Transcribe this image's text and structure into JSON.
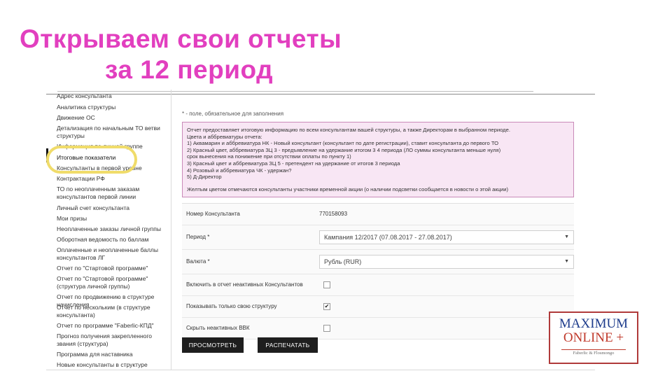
{
  "slide": {
    "title_line1": "Открываем свои отчеты",
    "title_line2": "за 12 период"
  },
  "sidebar": {
    "items": [
      "Адрес консультанта",
      "Аналитика структуры",
      "Движение ОС",
      "Детализация по начальным ТО ветви структуры",
      "Информация по личной группе",
      "Итоговые показатели",
      "Консультанты в первой уровне",
      "Контрактации РФ",
      "ТО по неоплаченным заказам консультантов первой линии",
      "Личный счет консультанта",
      "Мои призы",
      "Неоплаченные заказы личной группы",
      "Оборотная ведомость по баллам",
      "Оплаченные и неоплаченные баллы консультантов ЛГ",
      "Отчет по \"Стартовой программе\"",
      "Отчет по \"Стартовой программе\" (структура личной группы)",
      "Отчет по продвижению в структуре начисления",
      "Отчет по нескольким (в структуре консультанта)",
      "Отчет по программе \"Faberlic-КПД\"",
      "Прогноз получения закрепленного звания (структура)",
      "Программа для наставника",
      "Новые консультанты в структуре"
    ]
  },
  "main": {
    "note": "* - поле, обязательное для заполнения",
    "info_lines": [
      "Отчет предоставляет итоговую информацию по всем консультантам вашей структуры, а также Директорам в выбранном периоде.",
      "Цвета и аббревиатуры отчета:",
      "1) Аквамарин и аббревиатура НК - Новый консультант (консультант по дате регистрации), ставит консультанта до первого ТО",
      "2) Красный цвет, аббревиатура ЗЦ 3 - предъявление на удержание итогом 3 4 периода (ЛО суммы консультанта меньше нуля)",
      "срок вынесения на понижение при отсутствии оплаты по пункту 1)",
      "3) Красный цвет и аббревиатура ЗЦ 5 - претендент на удержание от итогов 3 периода",
      "4) Розовый и аббревиатура ЧК - удержан?",
      "5) Д-Директор"
    ],
    "info_footer": "Желтым цветом отмечаются консультанты участники временной акции (о наличии подсветки сообщается в новости о этой акции)",
    "consultant_label": "Номер Консультанта",
    "consultant_value": "770158093",
    "period_label": "Период *",
    "period_value": "Кампания 12/2017 (07.08.2017 - 27.08.2017)",
    "currency_label": "Валюта *",
    "currency_value": "Рубль (RUR)",
    "cb1_label": "Включить в отчет неактивных Консультантов",
    "cb2_label": "Показывать только свою структуру",
    "cb3_label": "Скрыть неактивных ВВК",
    "cb1_checked": "",
    "cb2_checked": "✔",
    "cb3_checked": "",
    "btn_view": "ПРОСМОТРЕТЬ",
    "btn_print": "РАСПЕЧАТАТЬ"
  },
  "logo": {
    "line1": "MAXIMUM",
    "line2": "ONLINE +",
    "line3": "Faberlic & Flosmongo"
  },
  "colors": {
    "title": "#e23fbf",
    "highlight_oval": "#f0dc6a",
    "info_bg": "#f8e6f4",
    "button_bg": "#1e1e1e"
  }
}
